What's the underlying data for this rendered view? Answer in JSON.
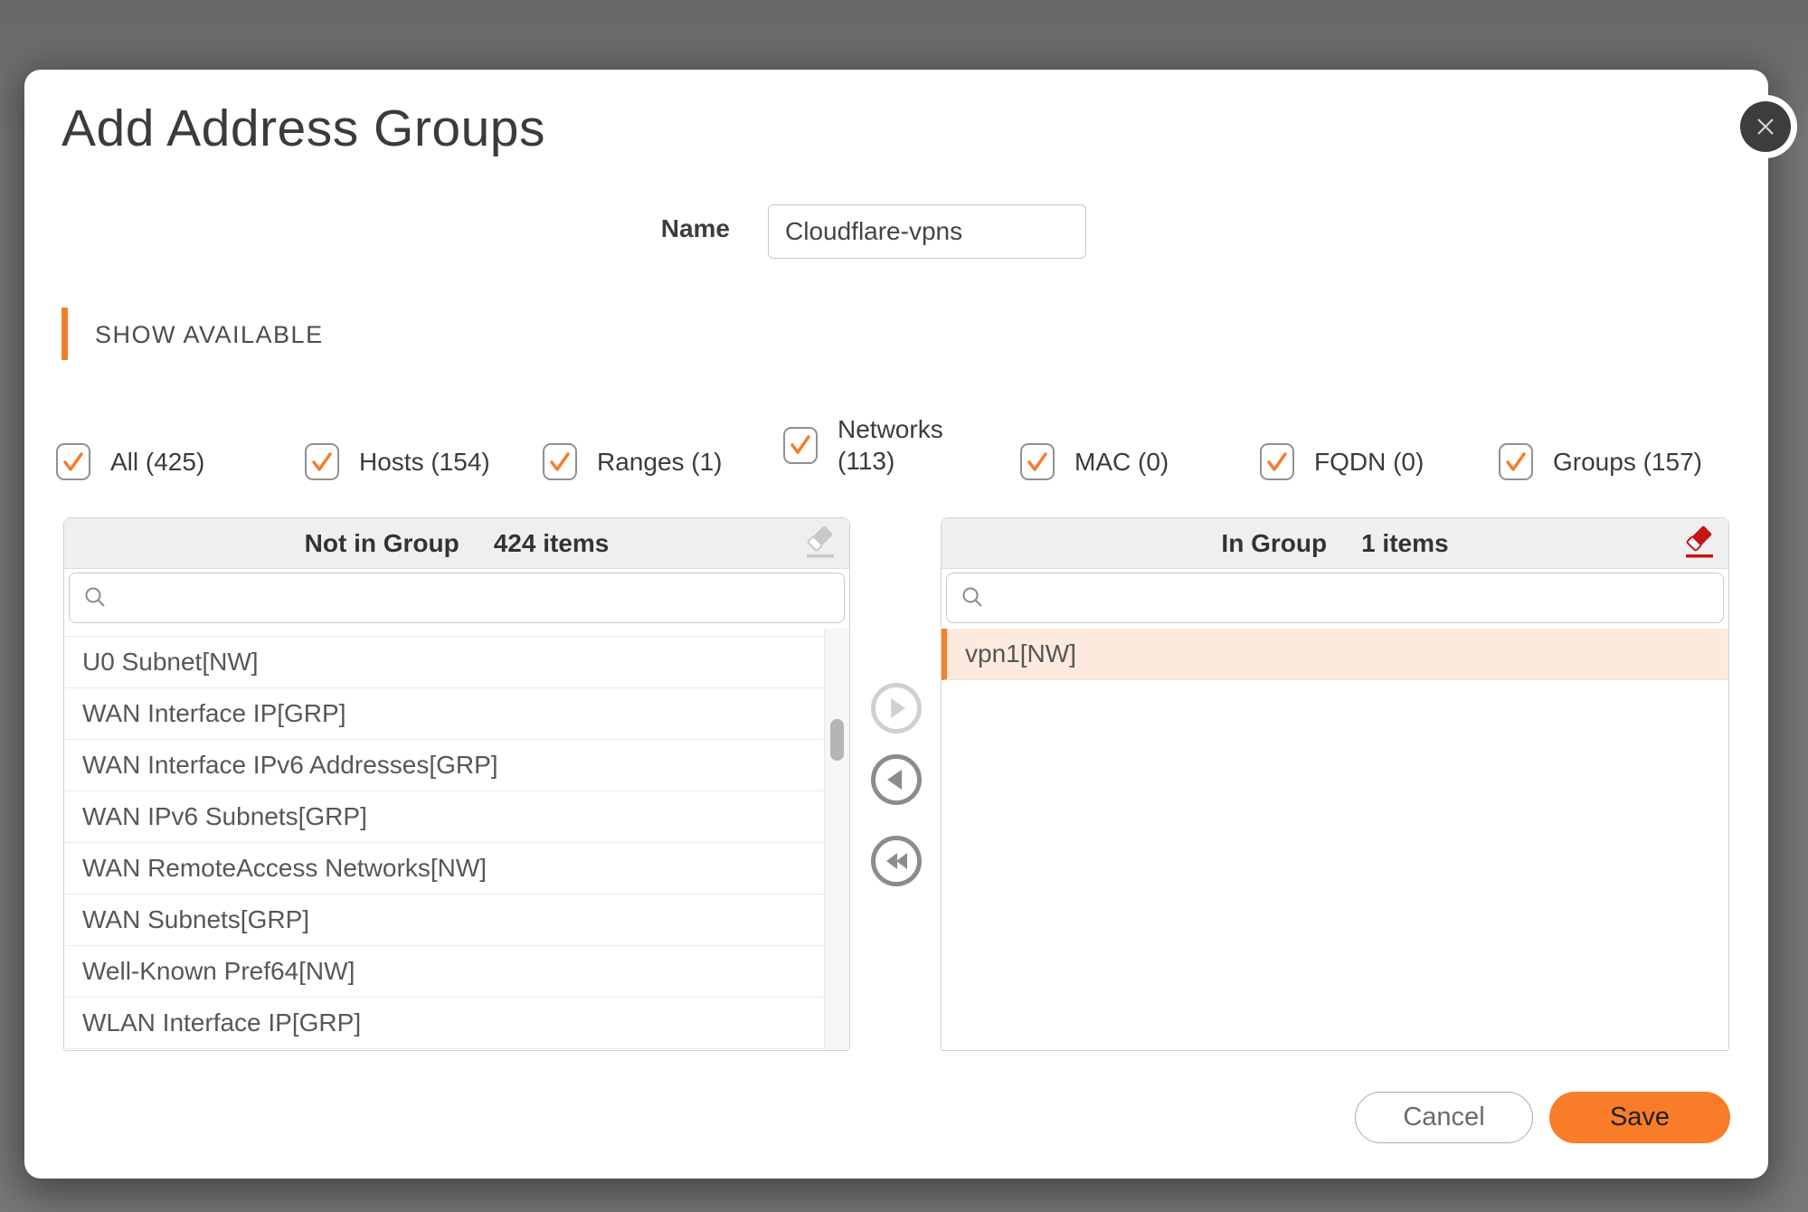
{
  "modal": {
    "title": "Add Address Groups",
    "name_field": {
      "label": "Name",
      "value": "Cloudflare-vpns"
    },
    "section_header": "SHOW AVAILABLE",
    "filters": [
      {
        "label": "All (425)",
        "checked": true
      },
      {
        "label": "Hosts (154)",
        "checked": true
      },
      {
        "label": "Ranges (1)",
        "checked": true
      },
      {
        "label": "Networks (113)",
        "checked": true
      },
      {
        "label": "MAC (0)",
        "checked": true
      },
      {
        "label": "FQDN (0)",
        "checked": true
      },
      {
        "label": "Groups (157)",
        "checked": true
      }
    ],
    "not_in_group": {
      "title": "Not in Group",
      "count_label": "424 items",
      "items": [
        "U0 Subnet[NW]",
        "WAN Interface IP[GRP]",
        "WAN Interface IPv6 Addresses[GRP]",
        "WAN IPv6 Subnets[GRP]",
        "WAN RemoteAccess Networks[NW]",
        "WAN Subnets[GRP]",
        "Well-Known Pref64[NW]",
        "WLAN Interface IP[GRP]"
      ]
    },
    "in_group": {
      "title": "In Group",
      "count_label": "1 items",
      "items": [
        "vpn1[NW]"
      ],
      "selected_item": "vpn1[NW]"
    },
    "icons": {
      "close": "close-icon",
      "search": "search-icon",
      "clear_list": "eraser-icon",
      "move_right": "arrow-right-circle-icon",
      "move_left": "arrow-left-circle-icon",
      "move_all_left": "double-arrow-left-circle-icon"
    },
    "footer": {
      "cancel_label": "Cancel",
      "save_label": "Save"
    },
    "colors": {
      "accent_orange": "#f57d2a",
      "save_button_orange": "#f97c28",
      "selected_row_bg": "#fdeade",
      "selected_row_border": "#f5822a",
      "eraser_red": "#c41414",
      "eraser_gray": "#c7c7c7",
      "panel_header_bg": "#efefef",
      "backdrop_gray": "#787878"
    }
  }
}
